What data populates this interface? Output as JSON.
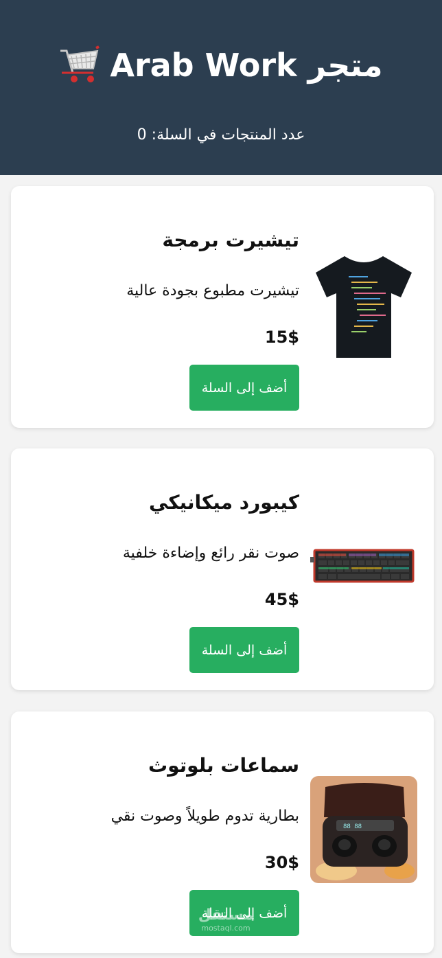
{
  "header": {
    "title": "متجر Arab Work",
    "cart_icon": "shopping-cart-icon",
    "counter_label": "عدد المنتجات في السلة: 0"
  },
  "products": [
    {
      "name": "تيشيرت برمجة",
      "description": "تيشيرت مطبوع بجودة عالية",
      "price": "15$",
      "button_label": "أضف إلى السلة",
      "image": "programming-tshirt-image"
    },
    {
      "name": "كيبورد ميكانيكي",
      "description": "صوت نقر رائع وإضاءة خلفية",
      "price": "45$",
      "button_label": "أضف إلى السلة",
      "image": "mechanical-keyboard-image"
    },
    {
      "name": "سماعات بلوتوث",
      "description": "بطارية تدوم طويلاً وصوت نقي",
      "price": "30$",
      "button_label": "أضف إلى السلة",
      "image": "bluetooth-earbuds-image"
    }
  ],
  "watermark": {
    "text": "مستقل",
    "domain": "mostaql.com"
  },
  "colors": {
    "header_bg": "#2c3e50",
    "button_bg": "#27ae60",
    "page_bg": "#f3f3f3"
  }
}
